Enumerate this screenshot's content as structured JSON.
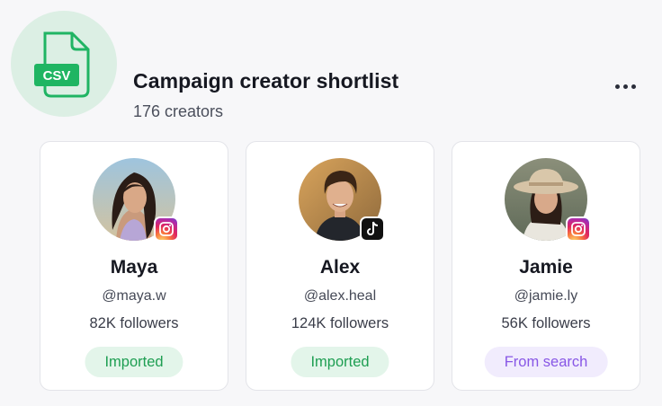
{
  "file_badge": {
    "label": "CSV",
    "icon": "csv-file-icon",
    "color": "#1fb562"
  },
  "header": {
    "title": "Campaign creator shortlist",
    "subtitle": "176 creators",
    "menu_icon": "more-horizontal-icon"
  },
  "creators": [
    {
      "name": "Maya",
      "handle": "@maya.w",
      "followers": "82K followers",
      "platform": "instagram",
      "status": "Imported",
      "status_color": "green"
    },
    {
      "name": "Alex",
      "handle": "@alex.heal",
      "followers": "124K followers",
      "platform": "tiktok",
      "status": "Imported",
      "status_color": "green"
    },
    {
      "name": "Jamie",
      "handle": "@jamie.ly",
      "followers": "56K followers",
      "platform": "instagram",
      "status": "From search",
      "status_color": "purple"
    }
  ],
  "colors": {
    "green_text": "#1e9e52",
    "green_bg": "#e3f5ea",
    "purple_text": "#8857e6",
    "purple_bg": "#f1ecfd"
  }
}
